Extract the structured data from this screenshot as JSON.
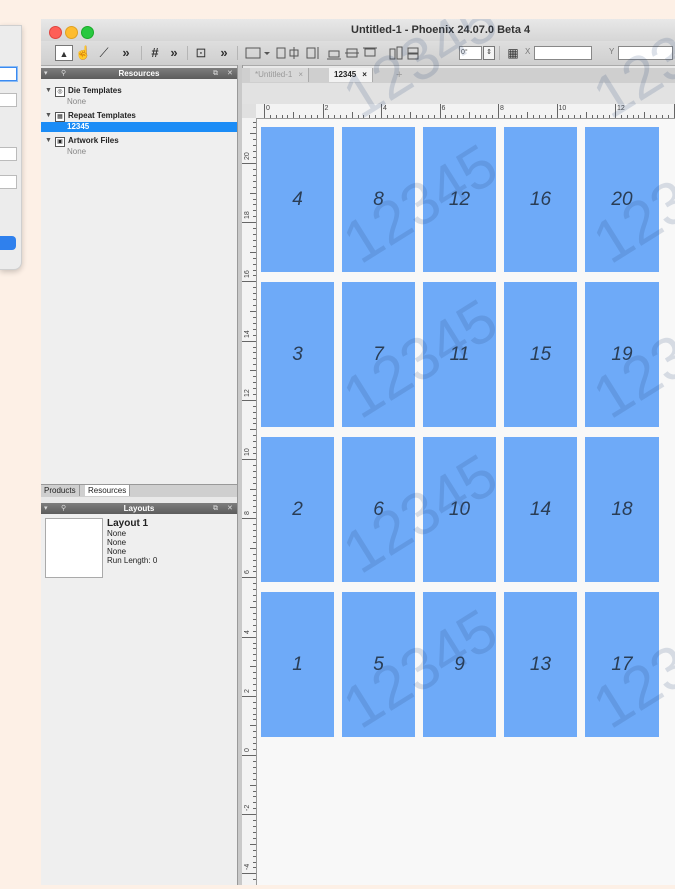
{
  "window": {
    "title": "Untitled-1 - Phoenix 24.07.0 Beta 4"
  },
  "toolbar": {
    "tools": [
      {
        "icon": "pointer-icon",
        "glyph": "▲"
      },
      {
        "icon": "hand-icon",
        "glyph": "☝"
      },
      {
        "icon": "knife-icon",
        "glyph": "⟋"
      },
      {
        "icon": "more-icon",
        "glyph": "»"
      },
      {
        "icon": "grid-icon",
        "glyph": "#"
      },
      {
        "icon": "more-icon",
        "glyph": "»"
      },
      {
        "icon": "zoom-icon",
        "glyph": "⊡"
      },
      {
        "icon": "more-icon",
        "glyph": "»"
      }
    ],
    "rotation_value": "0°",
    "x_label": "X",
    "y_label": "Y"
  },
  "resources_panel": {
    "title": "Resources",
    "groups": [
      {
        "label": "Die Templates",
        "items": [
          "None"
        ]
      },
      {
        "label": "Repeat Templates",
        "items": [
          "12345"
        ]
      },
      {
        "label": "Artwork Files",
        "items": [
          "None"
        ]
      }
    ],
    "selected_item": "12345"
  },
  "panel_tabs": [
    "Products",
    "Resources"
  ],
  "layouts_panel": {
    "title": "Layouts",
    "layout": {
      "name": "Layout 1",
      "details": [
        "None",
        "None",
        "None",
        "Run Length: 0"
      ]
    }
  },
  "document_tabs": [
    {
      "label": "*Untitled-1",
      "close": "×",
      "active": false
    },
    {
      "label": "12345",
      "close": "×",
      "active": true
    }
  ],
  "add_tab": "+",
  "rulers": {
    "horizontal": [
      "0",
      "2",
      "4",
      "6",
      "8",
      "10",
      "12"
    ],
    "vertical": [
      "20",
      "18",
      "16",
      "14",
      "12",
      "10",
      "8",
      "6",
      "4",
      "2",
      "0",
      "-2",
      "-4"
    ]
  },
  "repeat_grid": {
    "watermark": "12345",
    "columns": [
      [
        "4",
        "3",
        "2",
        "1"
      ],
      [
        "8",
        "7",
        "6",
        "5"
      ],
      [
        "12",
        "11",
        "10",
        "9"
      ],
      [
        "16",
        "15",
        "14",
        "13"
      ],
      [
        "20",
        "19",
        "18",
        "17"
      ]
    ],
    "cell_color": "#6eaaf8"
  },
  "colors": {
    "selection": "#1b8cf6",
    "dialog_button": "#2f80ed"
  }
}
